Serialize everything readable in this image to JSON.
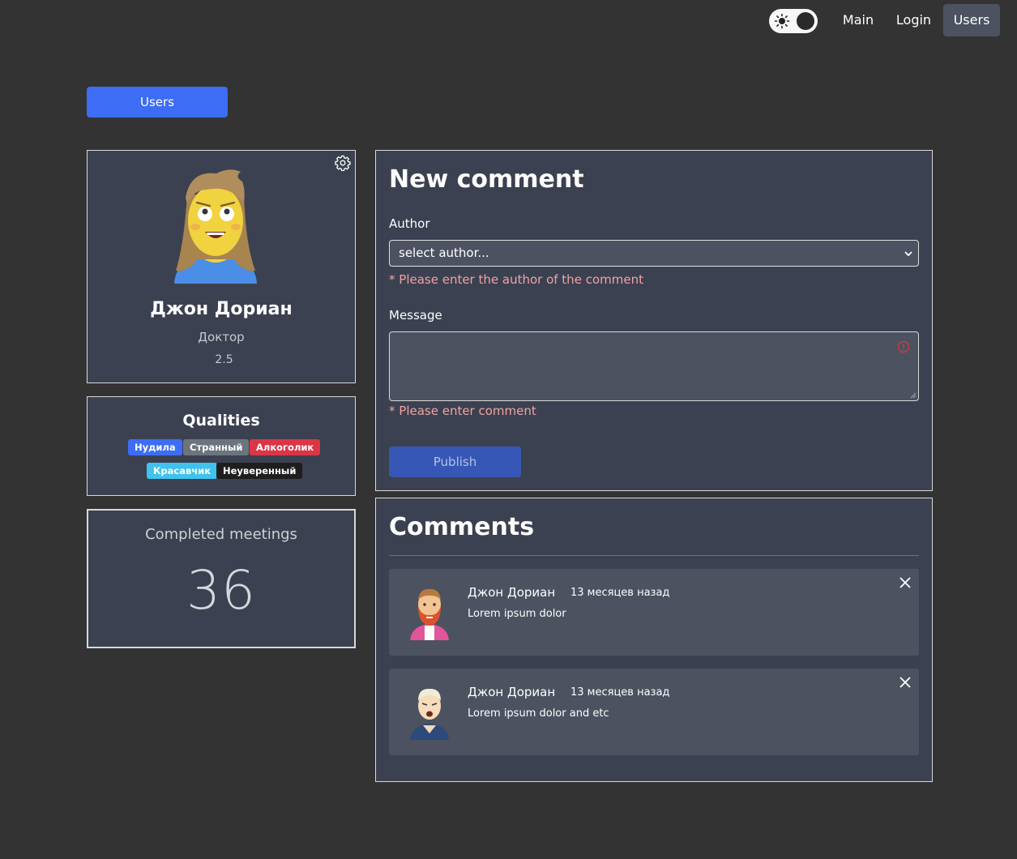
{
  "nav": {
    "theme_toggle_icon": "sun-icon",
    "links": [
      "Main",
      "Login",
      "Users"
    ],
    "active": "Users"
  },
  "back_button": {
    "label": "Users"
  },
  "profile": {
    "name": "Джон Дориан",
    "profession": "Доктор",
    "rate": "2.5",
    "settings_icon": "gear-icon"
  },
  "qualities": {
    "title": "Qualities",
    "items": [
      {
        "label": "Нудила",
        "color": "#3d6df5"
      },
      {
        "label": "Странный",
        "color": "#6c757d"
      },
      {
        "label": "Алкоголик",
        "color": "#dc3545"
      },
      {
        "label": "Красавчик",
        "color": "#3fc3ee"
      },
      {
        "label": "Неуверенный",
        "color": "#1e1e1e"
      }
    ]
  },
  "meetings": {
    "title": "Completed meetings",
    "value": "36"
  },
  "new_comment": {
    "title": "New comment",
    "author_label": "Author",
    "author_value": "select author...",
    "author_error": "* Please enter the author of the comment",
    "message_label": "Message",
    "message_value": "",
    "message_error": "* Please enter comment",
    "publish_label": "Publish"
  },
  "comments": {
    "title": "Comments",
    "items": [
      {
        "author": "Джон Дориан",
        "time": "13 месяцев назад",
        "text": "Lorem ipsum dolor"
      },
      {
        "author": "Джон Дориан",
        "time": "13 месяцев назад",
        "text": "Lorem ipsum dolor and etc"
      }
    ]
  },
  "colors": {
    "background": "#333333",
    "card": "#3b4150",
    "field": "#4c5260",
    "accent": "#3d6df5",
    "error": "#f0a3a3"
  }
}
